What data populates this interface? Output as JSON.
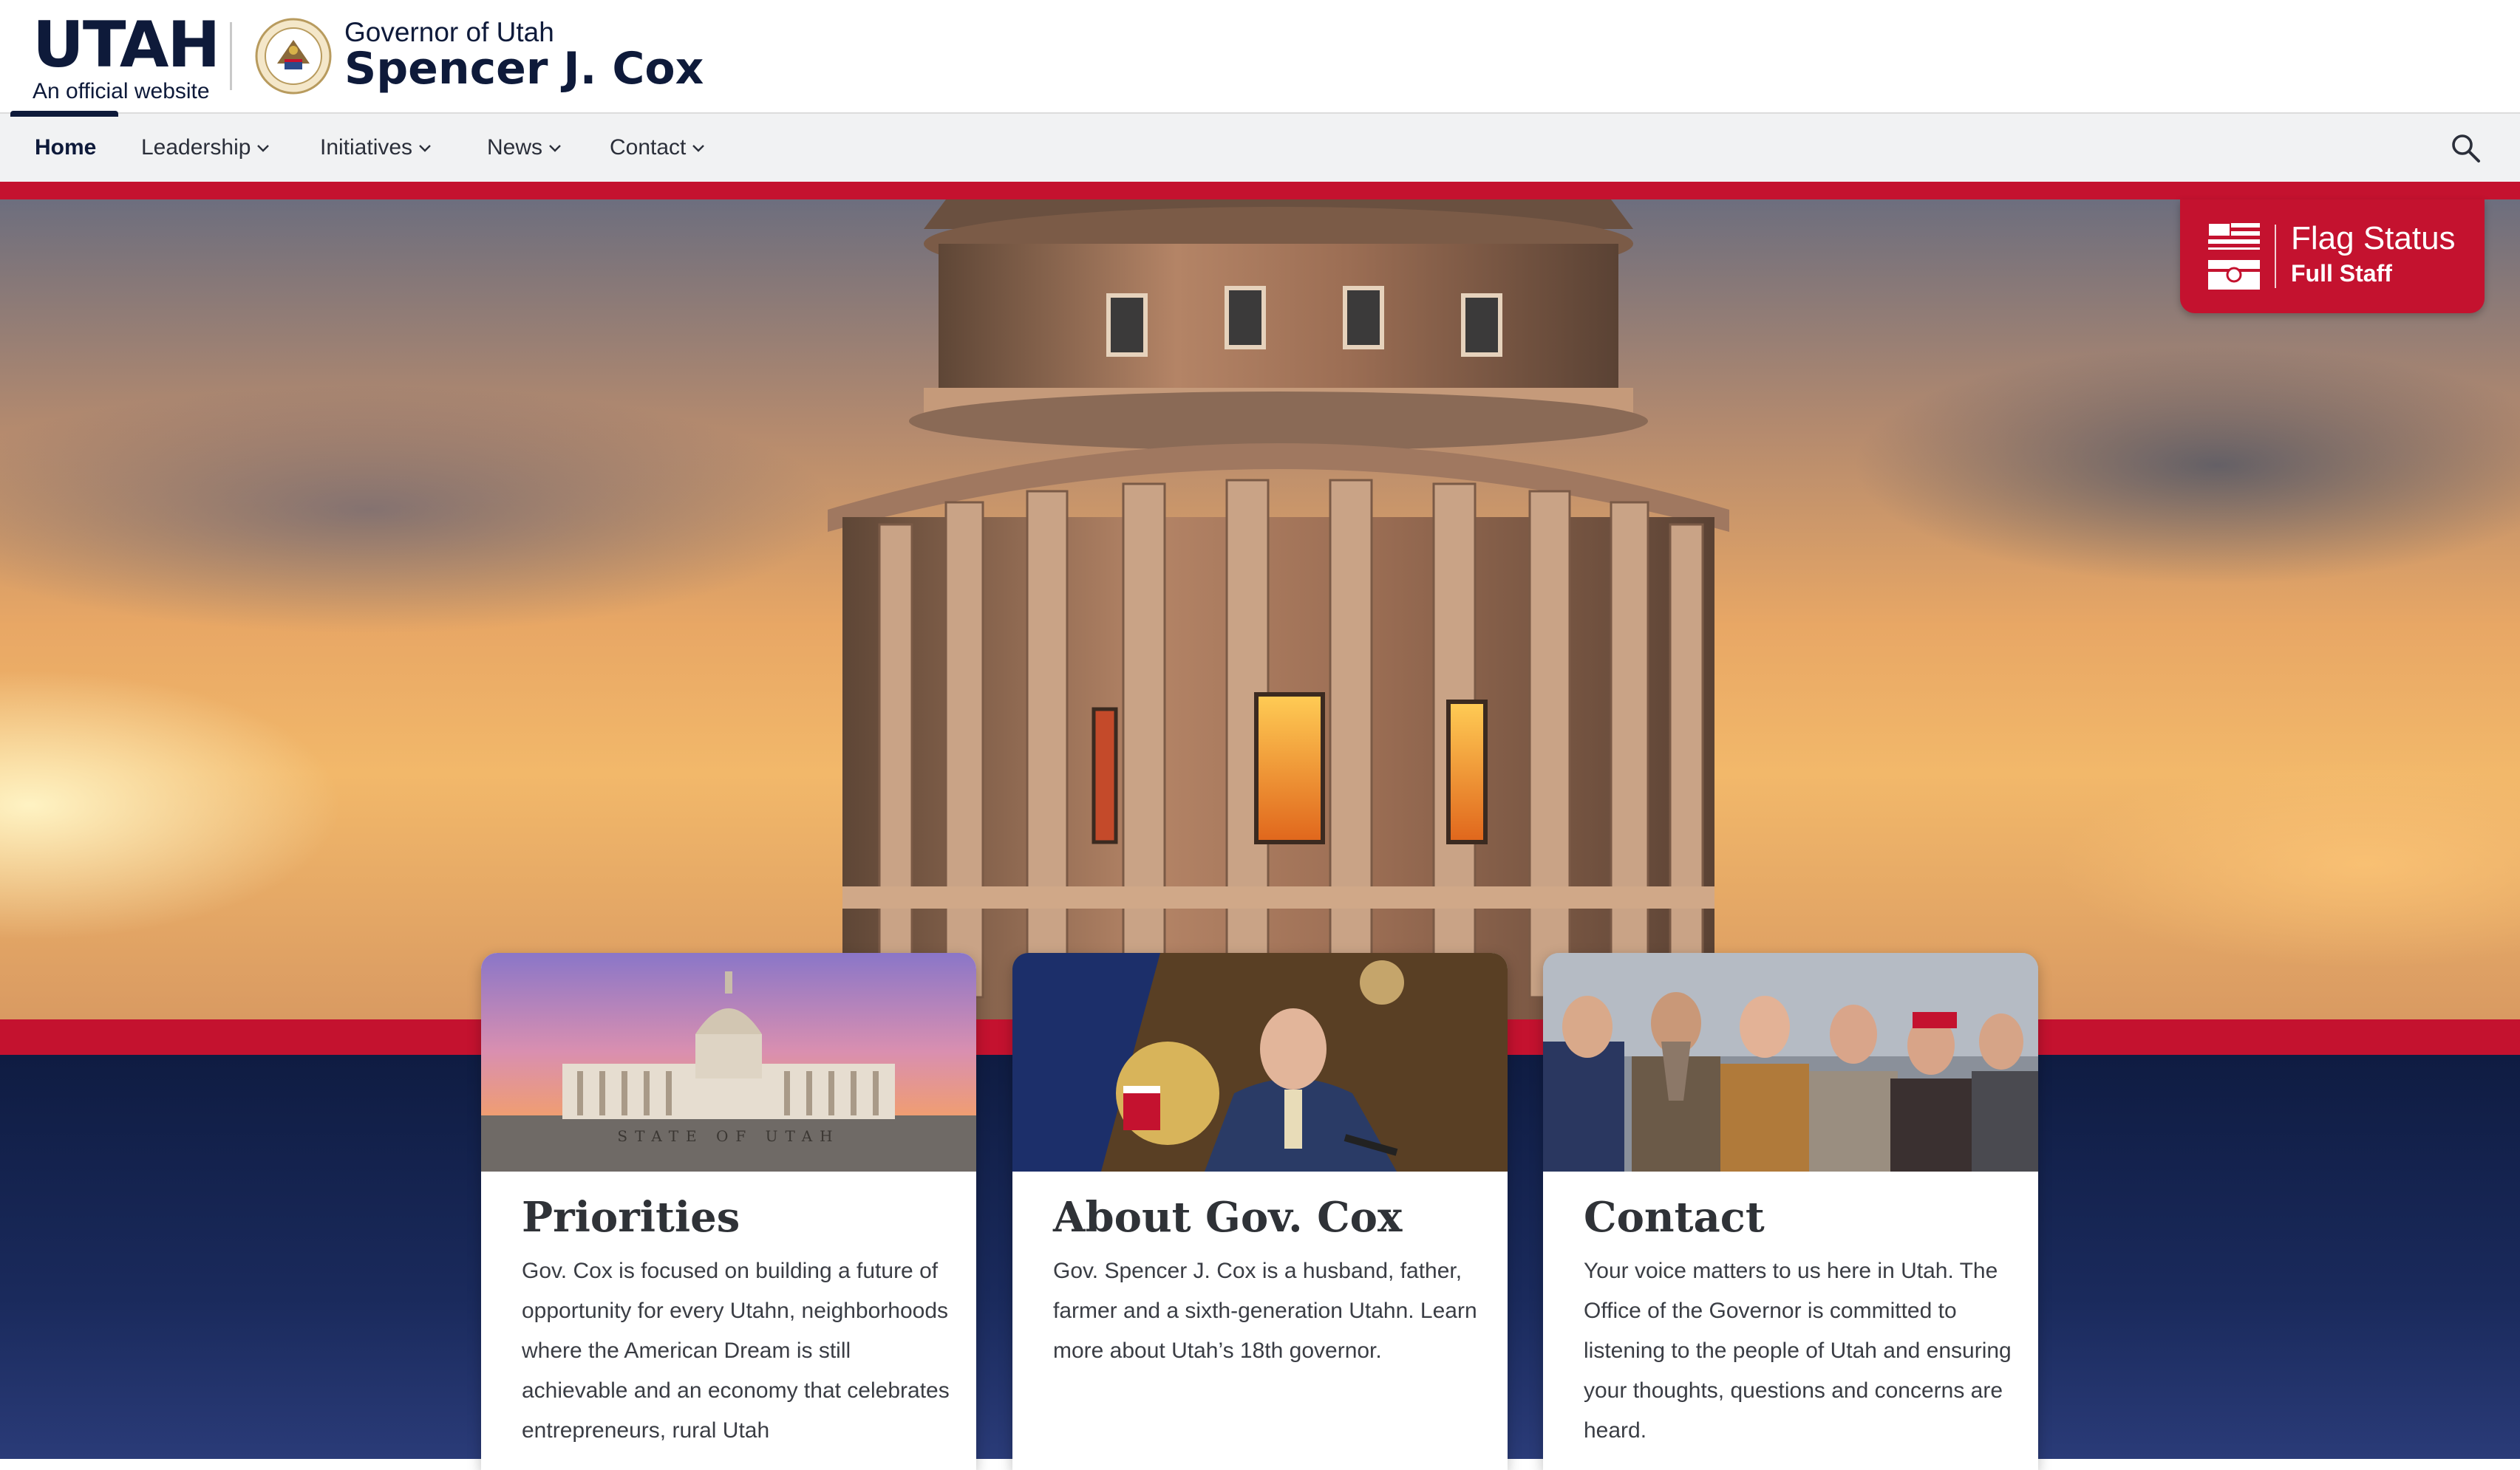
{
  "header": {
    "logo_text": "UTAH",
    "logo_subtext": "An official website",
    "office": "Governor of Utah",
    "name": "Spencer J. Cox"
  },
  "nav": {
    "items": [
      {
        "label": "Home",
        "active": true
      },
      {
        "label": "Leadership",
        "dropdown": true
      },
      {
        "label": "Initiatives",
        "dropdown": true
      },
      {
        "label": "News",
        "dropdown": true
      },
      {
        "label": "Contact",
        "dropdown": true
      }
    ],
    "search_icon": "search-icon"
  },
  "flag_status": {
    "title": "Flag Status",
    "status": "Full Staff",
    "icon": "flag-icon"
  },
  "cards": [
    {
      "title": "Priorities",
      "text": "Gov. Cox is focused on building a future of opportunity for every Utahn, neighborhoods where the American Dream is still achievable and an economy that celebrates entrepreneurs, rural Utah",
      "image_label": "STATE OF UTAH"
    },
    {
      "title": "About Gov. Cox",
      "text": "Gov. Spencer J. Cox is a husband, father, farmer and a sixth-generation Utahn. Learn more about Utah’s 18th governor."
    },
    {
      "title": "Contact",
      "text": "Your voice matters to us here in Utah. The Office of the Governor is committed to listening to the people of Utah and ensuring your thoughts, questions and concerns are heard."
    }
  ],
  "colors": {
    "navy": "#0e1a3a",
    "red": "#c4122f",
    "nav_bg": "#f1f2f3"
  }
}
